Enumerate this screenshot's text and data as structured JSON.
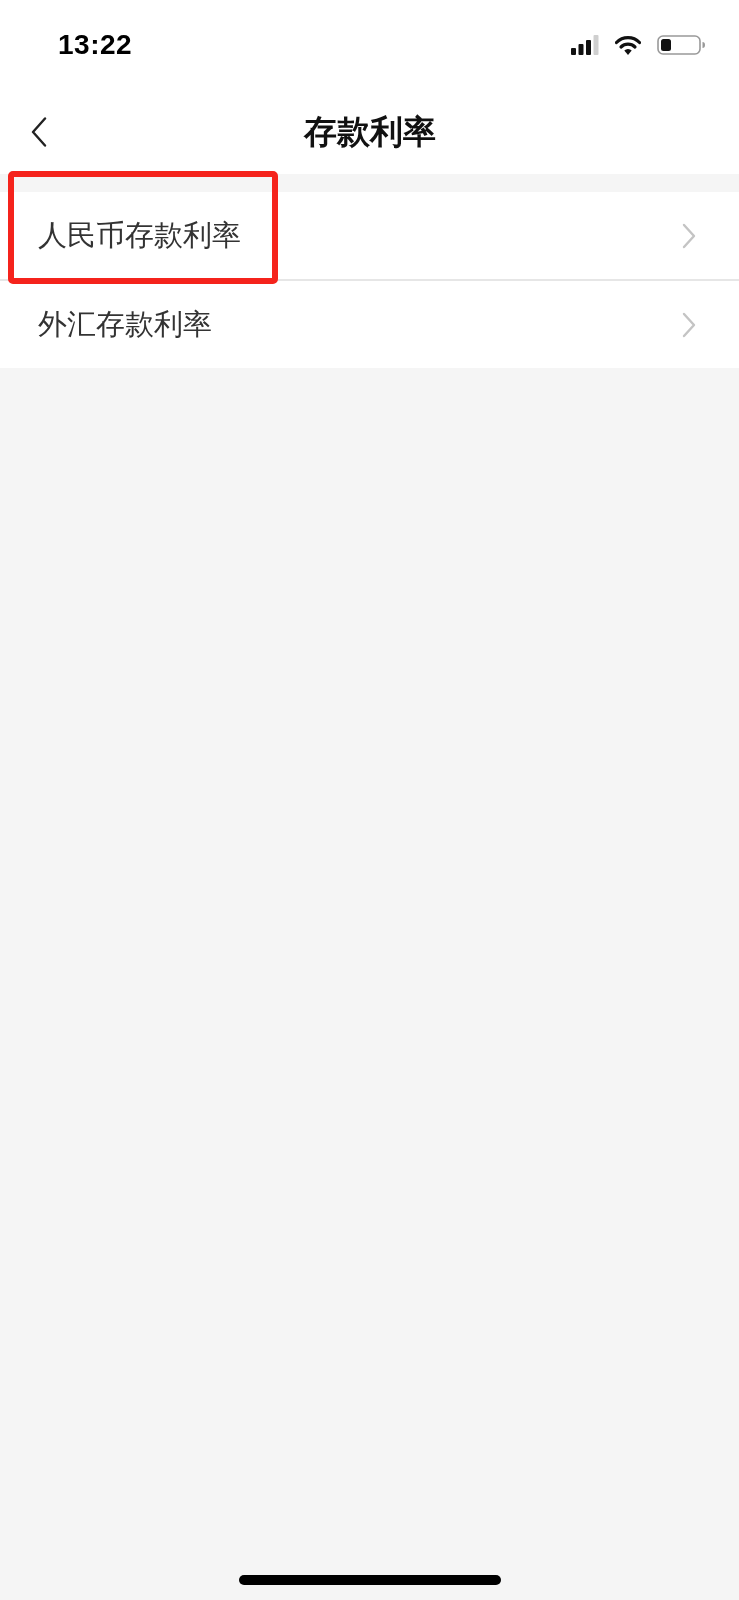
{
  "status_bar": {
    "time": "13:22"
  },
  "nav_bar": {
    "title": "存款利率"
  },
  "list": {
    "items": [
      {
        "label": "人民币存款利率",
        "highlighted": true
      },
      {
        "label": "外汇存款利率",
        "highlighted": false
      }
    ]
  }
}
